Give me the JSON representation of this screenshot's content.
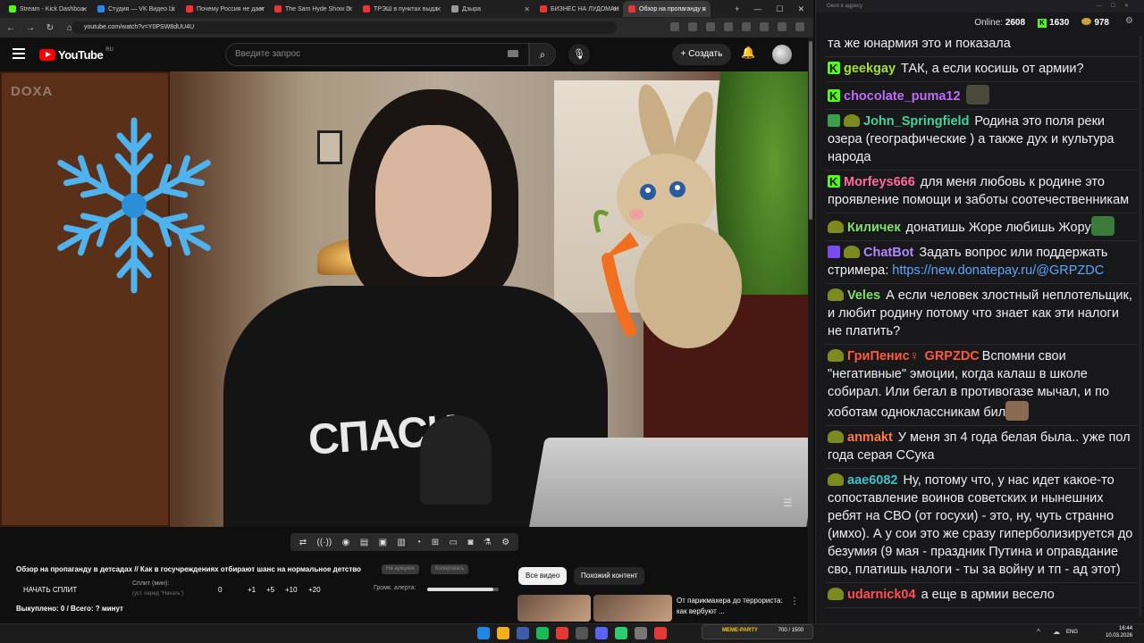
{
  "browser": {
    "tabs": [
      {
        "title": "Stream - Kick Dashboa",
        "fav": "k"
      },
      {
        "title": "Студия — VK Видео Li",
        "fav": "v"
      },
      {
        "title": "Почему Россия не дает",
        "fav": "y"
      },
      {
        "title": "The Sam Hyde Show D",
        "fav": "y"
      },
      {
        "title": "ТРЭШ в пунктах выда",
        "fav": "y"
      },
      {
        "title": "Дзыра",
        "fav": "d"
      },
      {
        "title": "БИЗНЕС НА ЛУДОМАН",
        "fav": "y"
      },
      {
        "title": "Обзор на пропаганду в",
        "fav": "y"
      }
    ],
    "url": "youtube.com/watch?v=Y0PSW8dUU4U"
  },
  "youtube": {
    "logo_text": "YouTube",
    "region": "RU",
    "search_placeholder": "Введите запрос",
    "create_label": "Создать",
    "video_watermark": "DOXA",
    "shirt_text": "СПАСИ",
    "video_title": "Обзор на пропаганду в детсадах // Как в госучреждениях отбирают шанс на нормальное детство",
    "pill_queue": "На аукцион",
    "pill_copy": "Копировать",
    "start_split": "НАЧАТЬ СПЛИТ",
    "split_label": "Сплит (мин):",
    "split_sub": "(уст. перед \"Начать\")",
    "split_values": [
      "0",
      "+1",
      "+5",
      "+10",
      "+20"
    ],
    "alert_label": "Громк. алерта:",
    "alert_volume": 0.92,
    "bought": "Выкуплено: 0 / Всего: ? минут",
    "chips": [
      "Все видео",
      "Похожий контент"
    ],
    "related_title": "От парикмахера до террориста: как вербуют ..."
  },
  "chat": {
    "window_title": "Окно в адресу",
    "online_label": "Online:",
    "online": "2608",
    "kick_count": "1630",
    "coin_count": "978",
    "messages": [
      {
        "user": "",
        "color": "#efeff1",
        "badges": [],
        "text": "та же юнармия это и показала"
      },
      {
        "user": "geekgay",
        "color": "#a6e22e",
        "badges": [
          "kick"
        ],
        "text": "ТАК, а если косишь от армии?"
      },
      {
        "user": "chocolate_puma12",
        "color": "#c06bff",
        "badges": [
          "kick"
        ],
        "text": "",
        "emote": "#4a4a3a"
      },
      {
        "user": "John_Springfield",
        "color": "#3fd49a",
        "badges": [
          "mod",
          "sub"
        ],
        "text": "Родина это  поля реки озера (географические ) а также дух и культура народа"
      },
      {
        "user": "Morfeys666",
        "color": "#ff6b9a",
        "badges": [
          "kick"
        ],
        "text": "для меня любовь к родине это проявление помощи и заботы соотечественникам"
      },
      {
        "user": "Киличек",
        "color": "#7ee06a",
        "badges": [
          "sub"
        ],
        "text": "донатишь Жоре любишь Жору",
        "emote": "#3a7a3a"
      },
      {
        "user": "ChatBot",
        "color": "#b388ff",
        "badges": [
          "bot",
          "sub"
        ],
        "text": "Задать вопрос или поддержать стримера:",
        "link": "https://new.donatepay.ru/@GRPZDC"
      },
      {
        "user": "Veles",
        "color": "#7ee06a",
        "badges": [
          "sub"
        ],
        "text": "А если человек злостный неплотельщик, и любит родину потому что знает как эти налоги не платить?"
      },
      {
        "user": "ГриПенис♀",
        "color": "#ff5a36",
        "user2": "GRPZDC",
        "badges": [
          "sub"
        ],
        "text": "Вспомни свои \"негативные\" эмоции, когда калаш в школе собирал. Или бегал в противогазе мычал, и по хоботам одноклассникам бил",
        "emote": "#8a6a50"
      },
      {
        "user": "anmakt",
        "color": "#ff7a3a",
        "badges": [
          "sub"
        ],
        "text": "У меня зп 4 года белая была.. уже пол года серая ССука"
      },
      {
        "user": "aae6082",
        "color": "#3fc0c8",
        "badges": [
          "sub"
        ],
        "text": "Ну, потому что, у нас идет какое-то сопоставление воинов советских и нынешних ребят на СВО (от госухи) - это, ну, чуть странно (имхо). А у сои это же сразу гиперболизируется до безумия (9 мая - праздник Путина и оправдание сво, платишь налоги - ты за войну и тп - ад этот)"
      },
      {
        "user": "udarnick04",
        "color": "#ff5050",
        "badges": [
          "sub"
        ],
        "text": "а еще в армии весело"
      }
    ]
  },
  "taskbar": {
    "overlay_label": "MEME-PARTY",
    "overlay_points": "700 / 1500",
    "lang": "ENG",
    "time": "16:44",
    "date": "10.03.2026"
  }
}
